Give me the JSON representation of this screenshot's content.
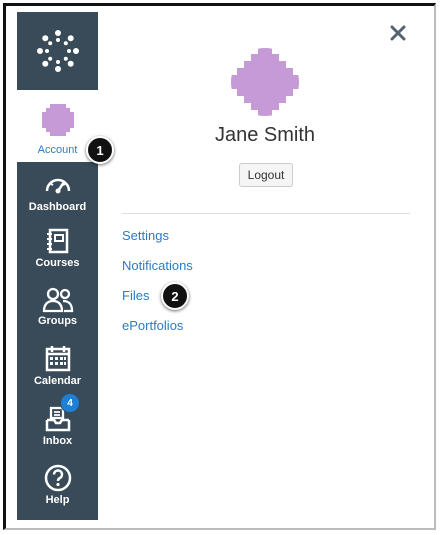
{
  "sidebar": {
    "account_label": "Account",
    "items": [
      {
        "label": "Dashboard",
        "icon": "dashboard-icon"
      },
      {
        "label": "Courses",
        "icon": "courses-icon"
      },
      {
        "label": "Groups",
        "icon": "groups-icon"
      },
      {
        "label": "Calendar",
        "icon": "calendar-icon"
      },
      {
        "label": "Inbox",
        "icon": "inbox-icon",
        "badge": "4"
      },
      {
        "label": "Help",
        "icon": "help-icon"
      }
    ]
  },
  "tray": {
    "user_name": "Jane Smith",
    "logout_label": "Logout",
    "links": [
      "Settings",
      "Notifications",
      "Files",
      "ePortfolios"
    ]
  },
  "callouts": [
    "1",
    "2"
  ],
  "colors": {
    "sidebar": "#394b58",
    "link": "#2d7bc1",
    "avatar": "#c59ad6",
    "badge": "#1d7fd6"
  }
}
